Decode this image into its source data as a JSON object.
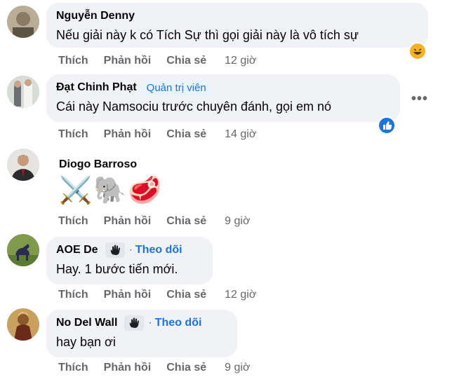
{
  "actions": {
    "like": "Thích",
    "reply": "Phản hồi",
    "share": "Chia sẻ"
  },
  "comments": [
    {
      "author": "Nguyễn Denny",
      "text": "Nếu giải này k có Tích Sự thì gọi giải này là vô tích sự",
      "time": "12 giờ",
      "reaction": "haha-icon"
    },
    {
      "author": "Đạt Chinh Phạt",
      "badge": "Quản trị viên",
      "text": "Cái này Namsociu trước chuyên đánh, gọi em nó",
      "time": "14 giờ",
      "reaction": "like-icon"
    },
    {
      "author": "Diogo Barroso",
      "emoji": [
        "⚔️",
        "🐘",
        "🥩"
      ],
      "time": "9 giờ"
    },
    {
      "author": "AOE De",
      "follow": "Theo dõi",
      "text": "Hay. 1 bước tiến mới.",
      "time": "12 giờ"
    },
    {
      "author": "No Del Wall",
      "follow": "Theo dõi",
      "text": "hay bạn ơi",
      "time": "9 giờ"
    }
  ],
  "more_menu": "•••",
  "separator": "·",
  "colors": {
    "accent": "#1b74e4",
    "bubble": "#f0f2f5",
    "muted": "#65676b"
  }
}
